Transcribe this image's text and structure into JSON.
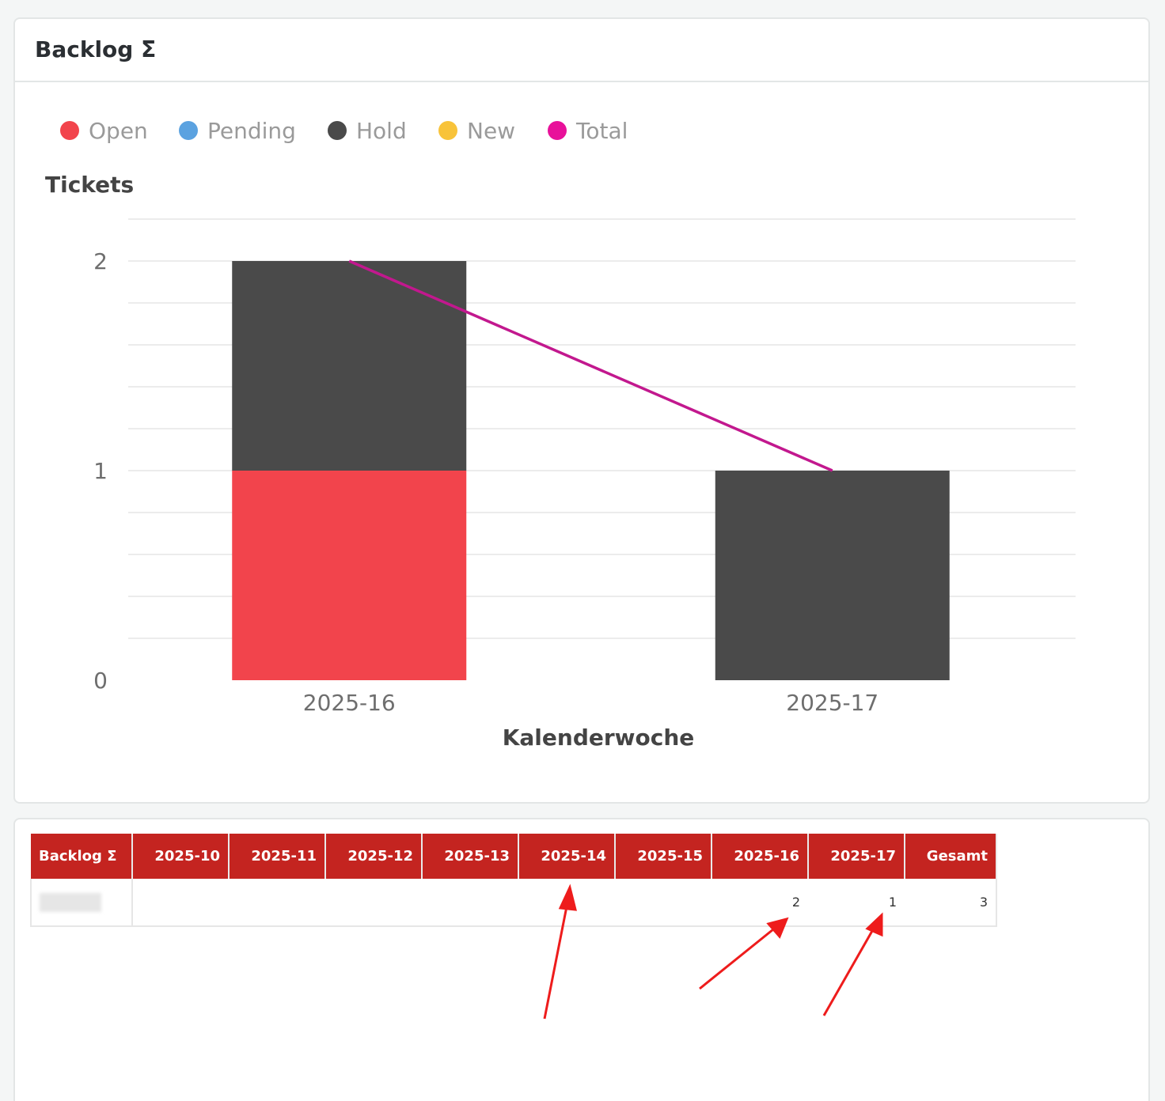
{
  "chart_panel": {
    "title": "Backlog Σ"
  },
  "legend": [
    {
      "label": "Open",
      "color": "#f2444c"
    },
    {
      "label": "Pending",
      "color": "#5ba2e0"
    },
    {
      "label": "Hold",
      "color": "#4a4a4a"
    },
    {
      "label": "New",
      "color": "#f8c33a"
    },
    {
      "label": "Total",
      "color": "#e8119a"
    }
  ],
  "chart_data": {
    "type": "bar",
    "stacked": true,
    "categories": [
      "2025-16",
      "2025-17"
    ],
    "series": [
      {
        "name": "Open",
        "values": [
          1,
          0
        ],
        "color": "#f2444c"
      },
      {
        "name": "Pending",
        "values": [
          0,
          0
        ],
        "color": "#5ba2e0"
      },
      {
        "name": "Hold",
        "values": [
          1,
          1
        ],
        "color": "#4a4a4a"
      },
      {
        "name": "New",
        "values": [
          0,
          0
        ],
        "color": "#f8c33a"
      }
    ],
    "line_series": {
      "name": "Total",
      "values": [
        2,
        1
      ],
      "color": "#c2188e"
    },
    "ylabel": "Tickets",
    "xlabel": "Kalenderwoche",
    "ylim": [
      0,
      2
    ],
    "yticks": [
      "0",
      "1",
      "2"
    ],
    "grid": true
  },
  "table": {
    "headers": [
      "Backlog Σ",
      "2025-10",
      "2025-11",
      "2025-12",
      "2025-13",
      "2025-14",
      "2025-15",
      "2025-16",
      "2025-17",
      "Gesamt"
    ],
    "rows": [
      {
        "cells": [
          "",
          "",
          "",
          "",
          "",
          "",
          "",
          "2",
          "1",
          "3"
        ]
      }
    ]
  }
}
